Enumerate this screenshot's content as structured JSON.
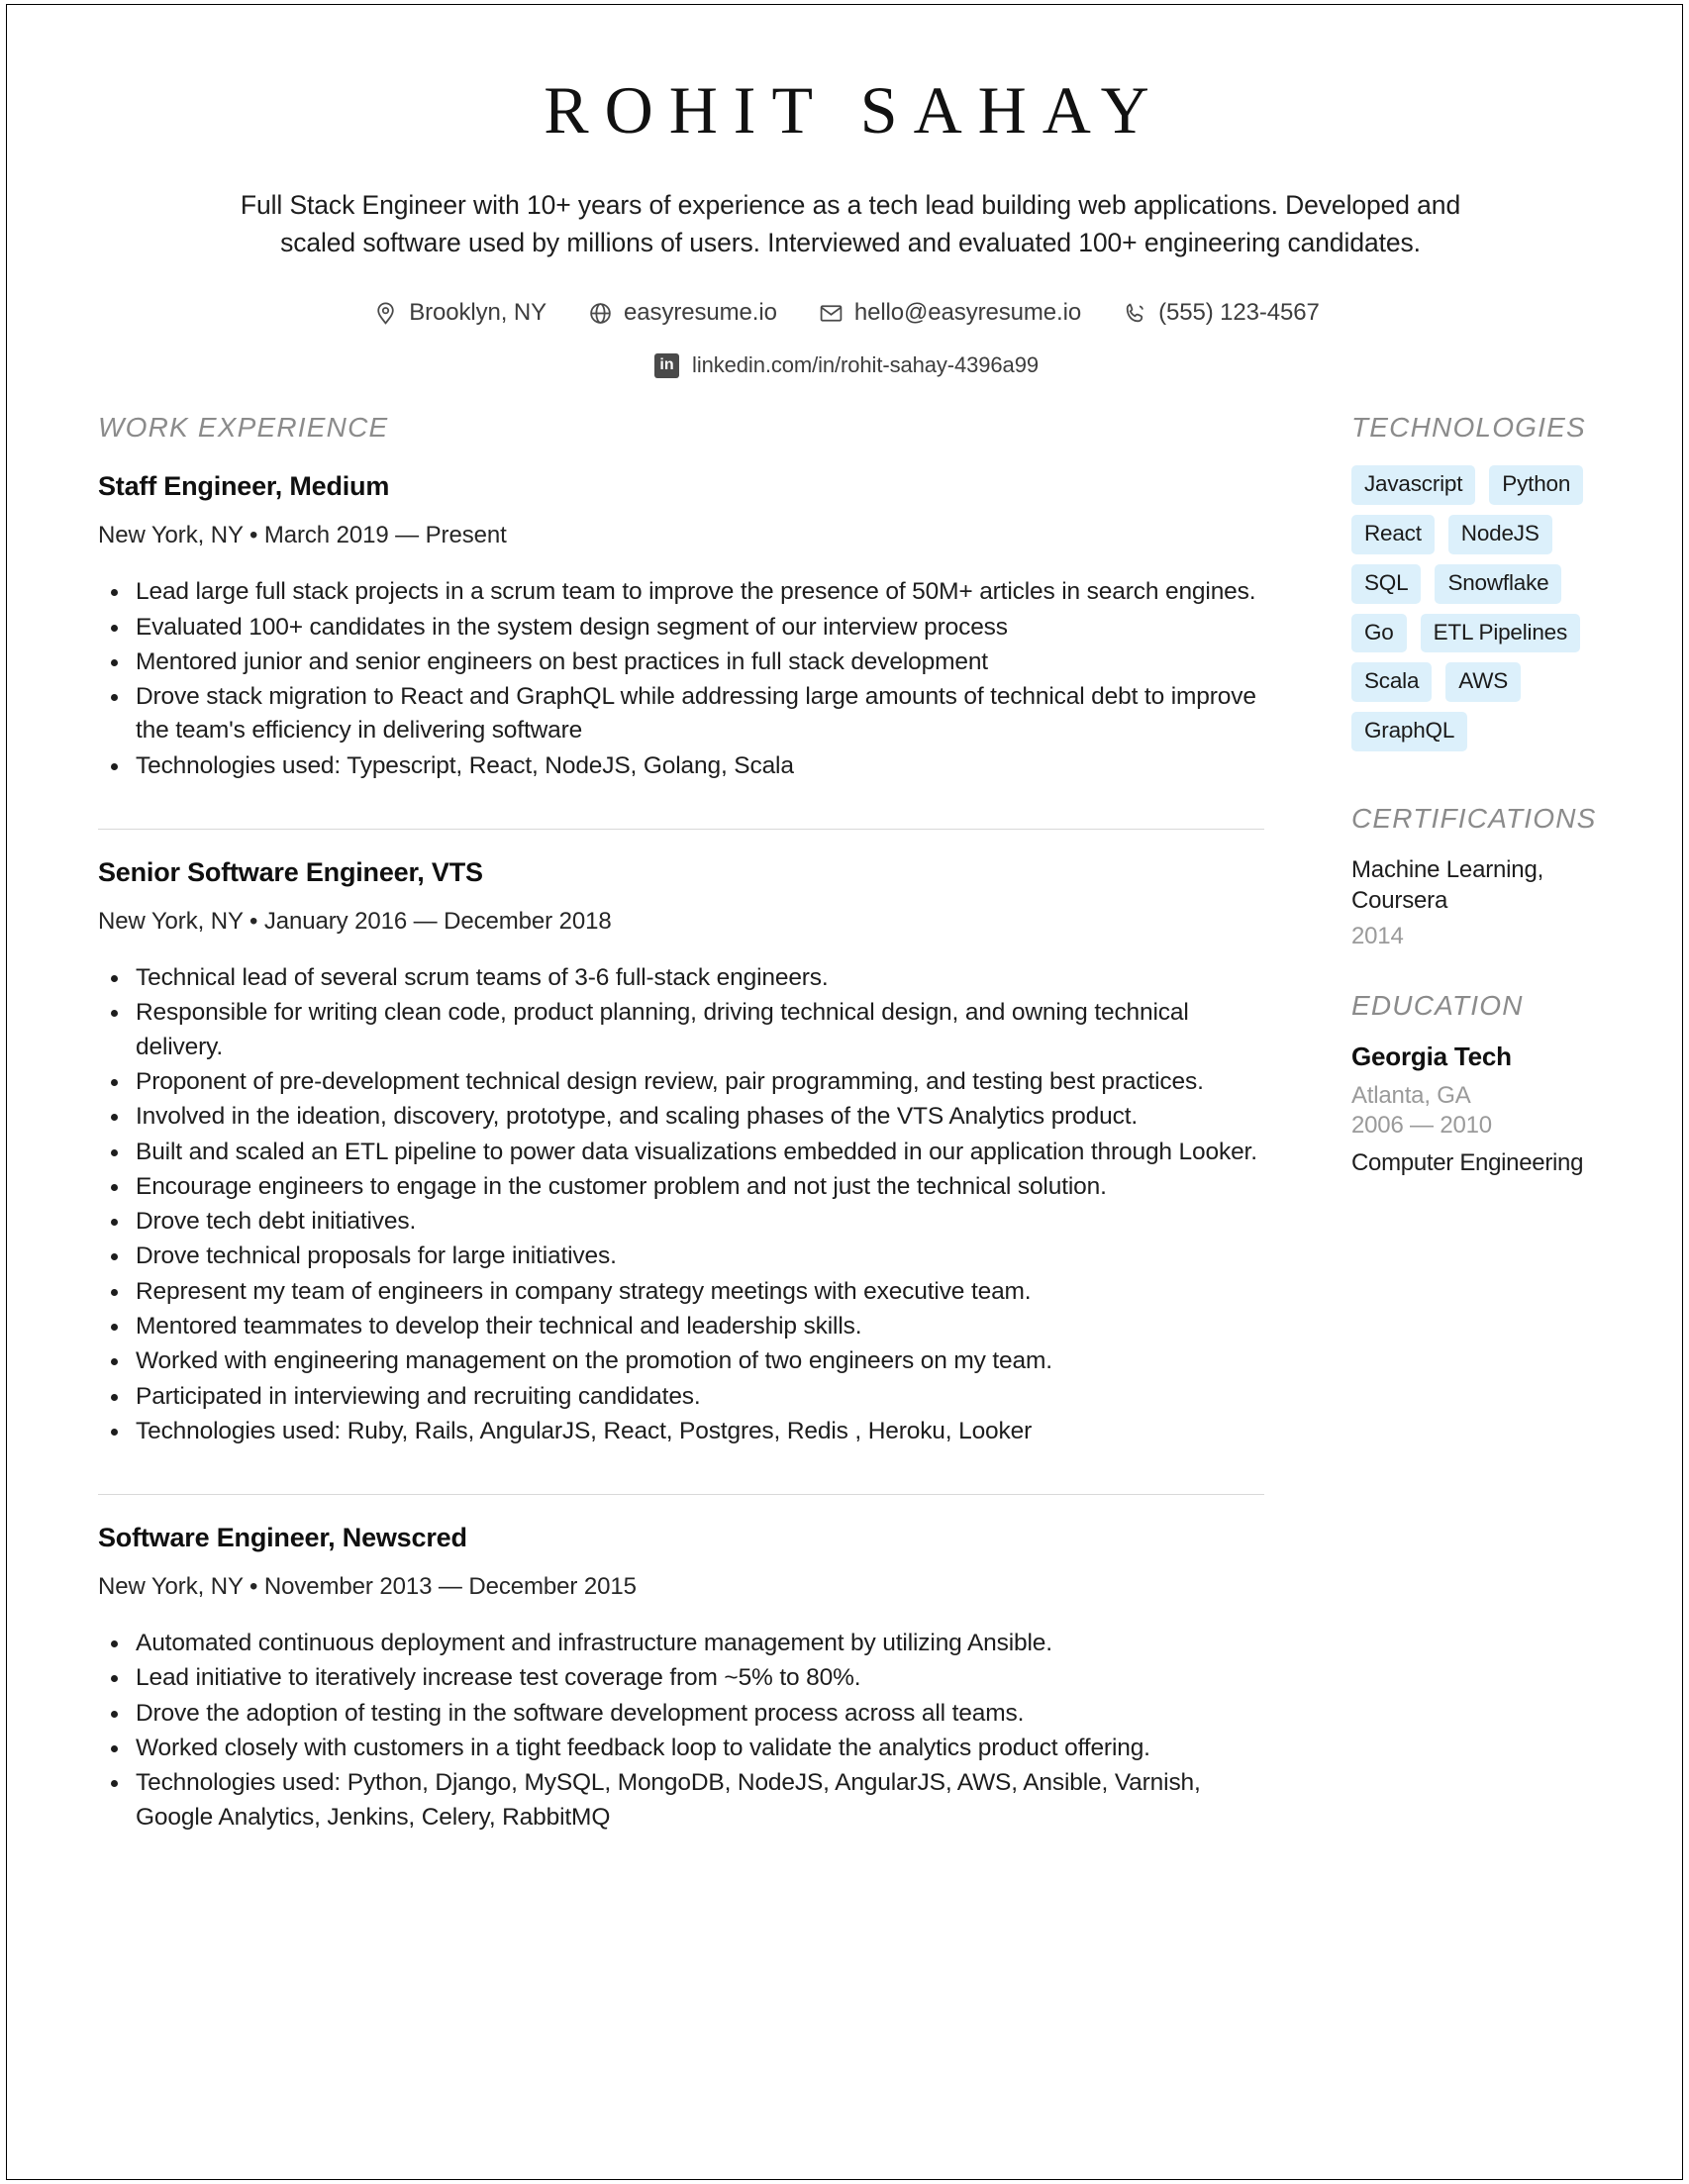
{
  "header": {
    "name": "ROHIT SAHAY",
    "summary": "Full Stack Engineer with 10+ years of experience as a tech lead building web applications. Developed and scaled software used by millions of users. Interviewed and evaluated 100+ engineering candidates.",
    "contacts": [
      {
        "icon": "location-pin-icon",
        "text": "Brooklyn, NY"
      },
      {
        "icon": "globe-icon",
        "text": "easyresume.io"
      },
      {
        "icon": "envelope-icon",
        "text": "hello@easyresume.io"
      },
      {
        "icon": "phone-icon",
        "text": "(555) 123-4567"
      }
    ],
    "linkedin": {
      "icon": "linkedin-icon",
      "badge_text": "in",
      "text": "linkedin.com/in/rohit-sahay-4396a99"
    }
  },
  "sections": {
    "work_experience_label": "WORK EXPERIENCE",
    "technologies_label": "TECHNOLOGIES",
    "certifications_label": "CERTIFICATIONS",
    "education_label": "EDUCATION"
  },
  "jobs": [
    {
      "title": "Staff Engineer, Medium",
      "meta": "New York, NY • March 2019 — Present",
      "bullets": [
        "Lead large full stack projects in a scrum team to improve the presence of 50M+ articles in search engines.",
        "Evaluated 100+ candidates in the system design segment of our interview process",
        "Mentored junior and senior engineers on best practices in full stack development",
        "Drove stack migration to React and GraphQL while addressing large amounts of technical debt to improve the team's efficiency in delivering software",
        "Technologies used: Typescript, React, NodeJS, Golang, Scala"
      ]
    },
    {
      "title": "Senior Software Engineer, VTS",
      "meta": "New York, NY • January 2016 — December 2018",
      "bullets": [
        "Technical lead of several scrum teams of 3-6 full-stack engineers.",
        "Responsible for writing clean code, product planning, driving technical design, and owning technical delivery.",
        "Proponent of pre-development technical design review, pair programming, and testing best practices.",
        "Involved in the ideation, discovery, prototype, and scaling phases of the VTS Analytics product.",
        "Built and scaled an ETL pipeline to power data visualizations embedded in our application through Looker.",
        "Encourage engineers to engage in the customer problem and not just the technical solution.",
        "Drove tech debt initiatives.",
        "Drove technical proposals for large initiatives.",
        "Represent my team of engineers in company strategy meetings with executive team.",
        "Mentored teammates to develop their technical and leadership skills.",
        "Worked with engineering management on the promotion of two engineers on my team.",
        "Participated in interviewing and recruiting candidates.",
        "Technologies used: Ruby, Rails, AngularJS, React, Postgres, Redis , Heroku, Looker"
      ]
    },
    {
      "title": "Software Engineer, Newscred",
      "meta": "New York, NY • November 2013 — December 2015",
      "bullets": [
        "Automated continuous deployment and infrastructure management by utilizing Ansible.",
        "Lead initiative to iteratively increase test coverage from ~5% to 80%.",
        "Drove the adoption of testing in the software development process across all teams.",
        "Worked closely with customers in a tight feedback loop to validate the analytics product offering.",
        "Technologies used: Python, Django, MySQL, MongoDB, NodeJS, AngularJS, AWS, Ansible, Varnish, Google Analytics, Jenkins, Celery, RabbitMQ"
      ]
    }
  ],
  "technologies": [
    "Javascript",
    "Python",
    "React",
    "NodeJS",
    "SQL",
    "Snowflake",
    "Go",
    "ETL Pipelines",
    "Scala",
    "AWS",
    "GraphQL"
  ],
  "certifications": [
    {
      "name": "Machine Learning, Coursera",
      "year": "2014"
    }
  ],
  "education": [
    {
      "school": "Georgia Tech",
      "location": "Atlanta, GA",
      "years": "2006 — 2010",
      "degree": "Computer Engineering"
    }
  ],
  "colors": {
    "tag_background": "#dcf0fb",
    "section_heading": "#8b8b8b",
    "muted_text": "#9a9a9a",
    "divider": "#d8d8d8"
  }
}
